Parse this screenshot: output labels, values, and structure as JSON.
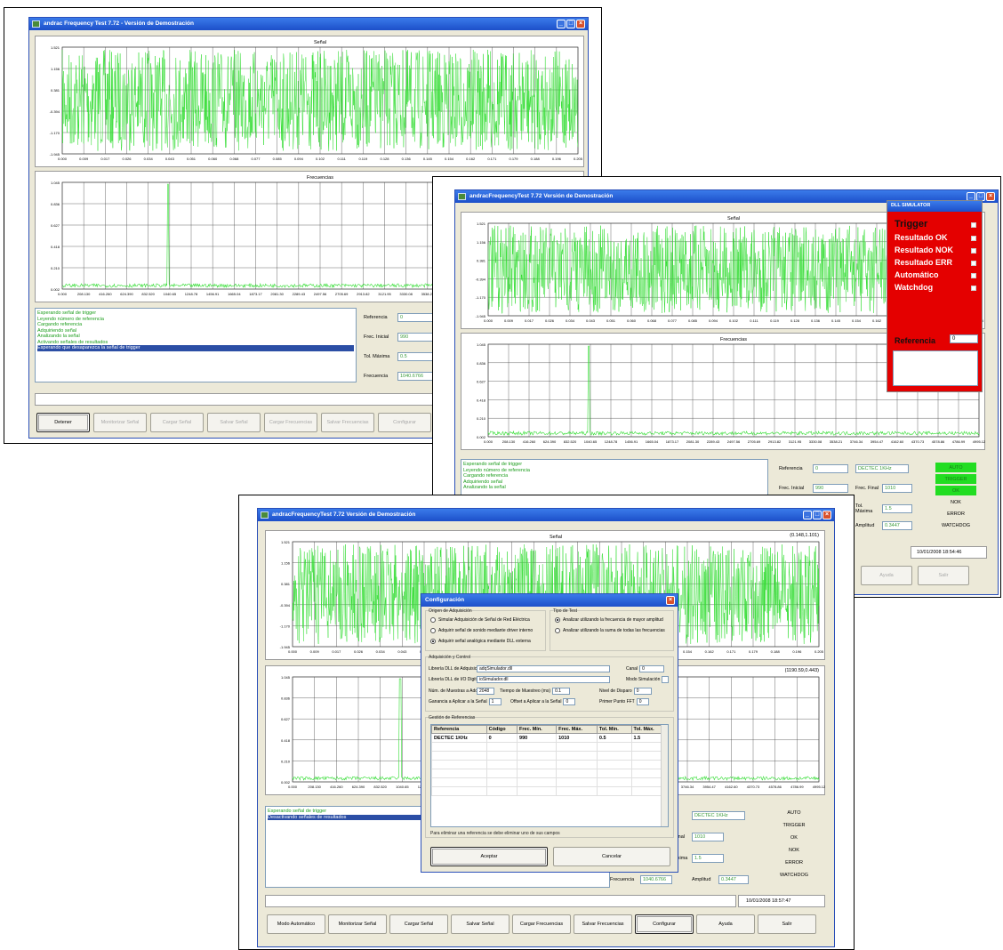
{
  "window_title": "andrac Frequency Test 7.72 - Versión de Demostración",
  "window_title_alt": "andracFrequencyTest 7.72 Versión de Demostración",
  "chart_signal_title": "Señal",
  "chart_freq_title": "Frecuencias",
  "signal_y_ticks": [
    "1.521",
    "1.156",
    "0.381",
    "-0.394",
    "-1.170",
    "-1.945"
  ],
  "signal_x_ticks": [
    "0.000",
    "0.009",
    "0.017",
    "0.026",
    "0.034",
    "0.043",
    "0.051",
    "0.060",
    "0.068",
    "0.077",
    "0.085",
    "0.094",
    "0.102",
    "0.111",
    "0.119",
    "0.128",
    "0.136",
    "0.145",
    "0.154",
    "0.162",
    "0.171",
    "0.179",
    "0.188",
    "0.196",
    "0.205"
  ],
  "freq_y_ticks": [
    "1.045",
    "0.836",
    "0.627",
    "0.418",
    "0.210",
    "0.002"
  ],
  "freq_x_ticks": [
    "0.000",
    "208.130",
    "416.260",
    "624.390",
    "832.520",
    "1040.65",
    "1248.78",
    "1456.91",
    "1665.04",
    "1873.17",
    "2081.30",
    "2289.43",
    "2497.56",
    "2705.69",
    "2913.82",
    "3121.95",
    "3330.08",
    "3538.21",
    "3746.34",
    "3954.47",
    "4162.60",
    "4370.73",
    "4578.86",
    "4786.99",
    "4995.12"
  ],
  "signal_cursor_readout": "(0.148,1.101)",
  "freq_cursor_readout": "(1190.59,0.443)",
  "window1": {
    "log": [
      "Esperando señal de trigger",
      "Leyendo número de referencia",
      "Cargando referencia",
      "Adquiriendo señal",
      "Analizando la señal",
      "Activando señales de resultados",
      "Esperando que desaparezca la señal de trigger"
    ],
    "fields": [
      {
        "label": "Referencia",
        "value": "0"
      },
      {
        "label": "Frec. Inicial",
        "value": "990"
      },
      {
        "label": "Tol. Máxima",
        "value": "0.5"
      },
      {
        "label": "Frecuencia",
        "value": "1040.6766"
      }
    ],
    "buttons": [
      "Detener",
      "Monitorizar Señal",
      "Cargar Señal",
      "Salvar Señal",
      "Cargar Frecuencias",
      "Salvar Frecuencias",
      "Configurar"
    ]
  },
  "window2": {
    "log": [
      "Esperando señal de trigger",
      "Leyendo número de referencia",
      "Cargando referencia",
      "Adquiriendo señal",
      "Analizando la señal"
    ],
    "fields_left": [
      {
        "label": "Referencia",
        "value": "0"
      },
      {
        "label": "Frec. Inicial",
        "value": "990"
      }
    ],
    "fields_right": [
      {
        "label": "",
        "value": "DECTEC 1KHz"
      },
      {
        "label": "Frec. Final",
        "value": "1010"
      },
      {
        "label": "Tol. Máxima",
        "value": "1.5"
      },
      {
        "label": "Amplitud",
        "value": "0.3447"
      }
    ],
    "indicators": [
      {
        "label": "AUTO",
        "on": true
      },
      {
        "label": "TRIGGER",
        "on": true
      },
      {
        "label": "OK",
        "on": true
      },
      {
        "label": "NOK",
        "on": false
      },
      {
        "label": "ERROR",
        "on": false
      },
      {
        "label": "WATCHDOG",
        "on": false
      }
    ],
    "timestamp": "10/01/2008 18:54:46",
    "buttons": [
      "Ayuda",
      "Salir"
    ]
  },
  "simulator": {
    "title": "DLL SIMULATOR",
    "rows": [
      "Trigger",
      "Resultado OK",
      "Resultado NOK",
      "Resultado ERR",
      "Automático",
      "Watchdog"
    ],
    "ref_label": "Referencia",
    "ref_value": "0"
  },
  "window3": {
    "log": [
      "Esperando señal de trigger",
      "Desactivando señales de resultados"
    ],
    "fields": [
      {
        "label": "Frec. Final",
        "value": "1010"
      },
      {
        "label": "Tol. Máxima",
        "value": "1.5"
      },
      {
        "label": "Frecuencia",
        "value": "1040.6766"
      },
      {
        "label": "Amplitud",
        "value": "0.3447"
      }
    ],
    "field_ref_value": "DECTEC 1KHz",
    "indicators": [
      "AUTO",
      "TRIGGER",
      "OK",
      "NOK",
      "ERROR",
      "WATCHDOG"
    ],
    "timestamp": "10/01/2008 18:57:47",
    "buttons": [
      "Modo Automático",
      "Monitorizar Señal",
      "Cargar Señal",
      "Salvar Señal",
      "Cargar Frecuencias",
      "Salvar Frecuencias",
      "Configurar",
      "Ayuda",
      "Salir"
    ]
  },
  "dialog": {
    "title": "Configuración",
    "origin_group": "Origen de Adquisición",
    "origin_options": [
      {
        "label": "Simular Adquisición de Señal de Red Eléctrica",
        "on": false
      },
      {
        "label": "Adquirir señal de sonido mediante driver interno",
        "on": false
      },
      {
        "label": "Adquirir señal analógica mediante DLL externa",
        "on": true
      }
    ],
    "test_group": "Tipo de Test",
    "test_options": [
      {
        "label": "Analizar utilizando la frecuencia de mayor amplitud",
        "on": true
      },
      {
        "label": "Analizar utilizando la suma de todas las frecuencias",
        "on": false
      }
    ],
    "acq_group": "Adquisición y Control",
    "lib_acq_label": "Librería DLL de Adquisición",
    "lib_acq_value": "adqSimulador.dll",
    "lib_io_label": "Librería DLL de I/O Digitales",
    "lib_io_value": "ioSimulador.dll",
    "channel_label": "Canal",
    "channel_value": "0",
    "sim_mode_label": "Modo Simulación",
    "samples_label": "Núm. de Muestras a Adquirir",
    "samples_value": "2048",
    "sample_time_label": "Tiempo de Muestreo (ms)",
    "sample_time_value": "0.1",
    "trigger_label": "Nivel de Disparo",
    "trigger_value": "0",
    "gain_label": "Ganancia a Aplicar a la Señal",
    "gain_value": "1",
    "offset_label": "Offset a Aplicar a la Señal",
    "offset_value": "0",
    "fft_label": "Primer Punto FFT",
    "fft_value": "0",
    "ref_group": "Gestión de Referencias",
    "table_headers": [
      "Referencia",
      "Código",
      "Frec. Mín.",
      "Frec. Máx.",
      "Tol. Mín.",
      "Tol. Máx."
    ],
    "table_rows": [
      [
        "DECTEC 1KHz",
        "0",
        "990",
        "1010",
        "0.5",
        "1.5"
      ]
    ],
    "hint": "Para eliminar una referencia se debe eliminar uno de sus campos",
    "accept": "Aceptar",
    "cancel": "Cancelar"
  }
}
